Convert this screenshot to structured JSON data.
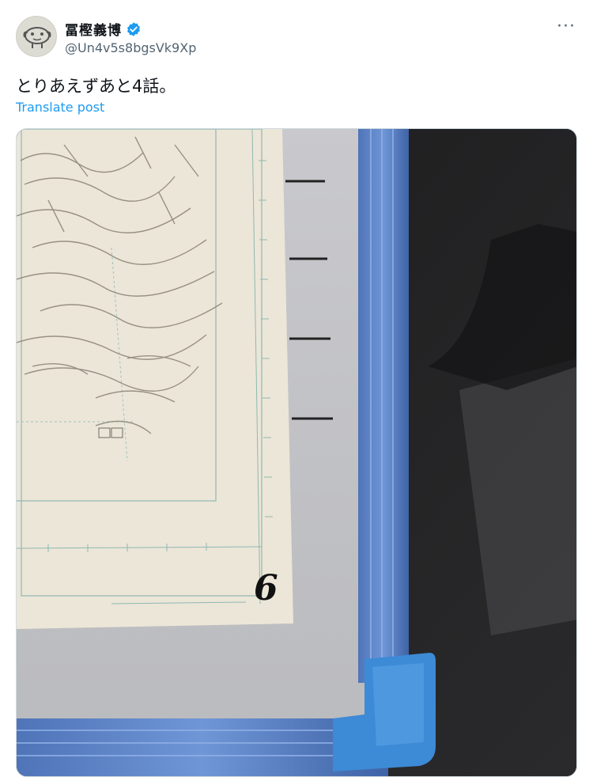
{
  "author": {
    "display_name": "冨樫義博",
    "handle": "@Un4v5s8bgsVk9Xp",
    "verified_icon": "verified-badge-icon",
    "avatar_icon": "cartoon-face-avatar"
  },
  "post": {
    "text": "とりあえずあと4話。",
    "translate_label": "Translate post",
    "more_label": "···",
    "image_annotation": "6"
  },
  "colors": {
    "link": "#1d9bf0",
    "verified": "#1d9bf0",
    "secondary_text": "#536471",
    "primary_text": "#0f1419"
  }
}
